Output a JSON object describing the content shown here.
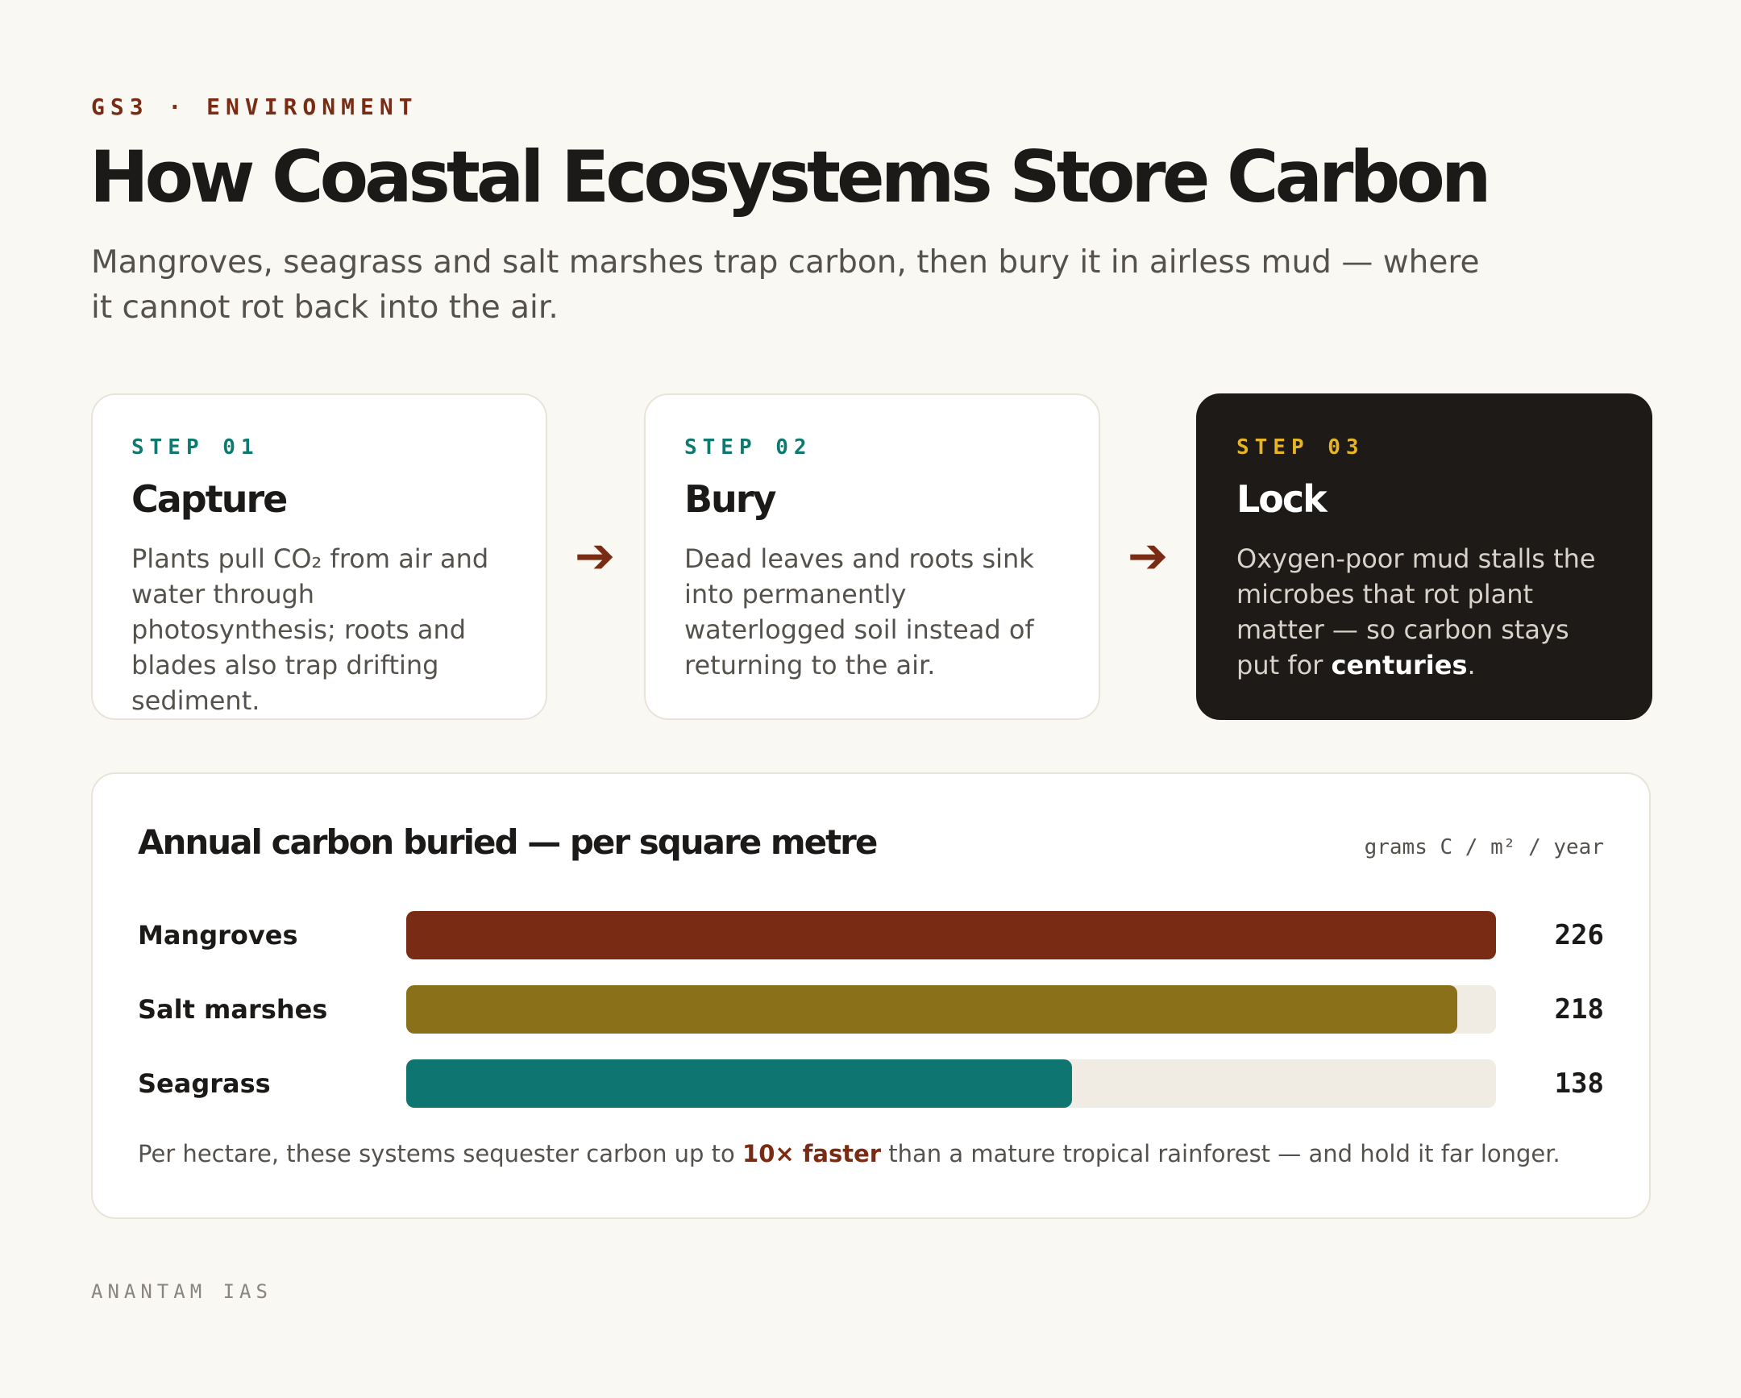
{
  "header": {
    "eyebrow": "GS3 · ENVIRONMENT",
    "title": "How Coastal Ecosystems Store Carbon",
    "subtitle": "Mangroves, seagrass and salt marshes trap carbon, then bury it in airless mud — where it cannot rot back into the air."
  },
  "steps": [
    {
      "label": "STEP 01",
      "title": "Capture",
      "body": "Plants pull CO₂ from air and water through photosynthesis; roots and blades also trap drifting sediment."
    },
    {
      "label": "STEP 02",
      "title": "Bury",
      "body": "Dead leaves and roots sink into permanently waterlogged soil instead of returning to the air."
    },
    {
      "label": "STEP 03",
      "title": "Lock",
      "body_lead": "Oxygen-poor mud stalls the microbes that rot plant matter — so carbon stays put for ",
      "body_strong": "centuries",
      "body_tail": "."
    }
  ],
  "arrow_glyph": "➔",
  "chart_data": {
    "type": "bar",
    "orientation": "horizontal",
    "title": "Annual carbon buried — per square metre",
    "units": "grams C / m² / year",
    "categories": [
      "Mangroves",
      "Salt marshes",
      "Seagrass"
    ],
    "values": [
      226,
      218,
      138
    ],
    "value_labels": [
      "226",
      "218",
      "138"
    ],
    "xlim": [
      0,
      226
    ],
    "colors": [
      "#7a2b14",
      "#8a7119",
      "#0e7570"
    ],
    "grid": false,
    "legend": "none"
  },
  "note": {
    "lead": "Per hectare, these systems sequester carbon up to ",
    "highlight": "10× faster",
    "tail": " than a mature tropical rainforest — and hold it far longer."
  },
  "footer": {
    "brand": "ANANTAM IAS"
  }
}
